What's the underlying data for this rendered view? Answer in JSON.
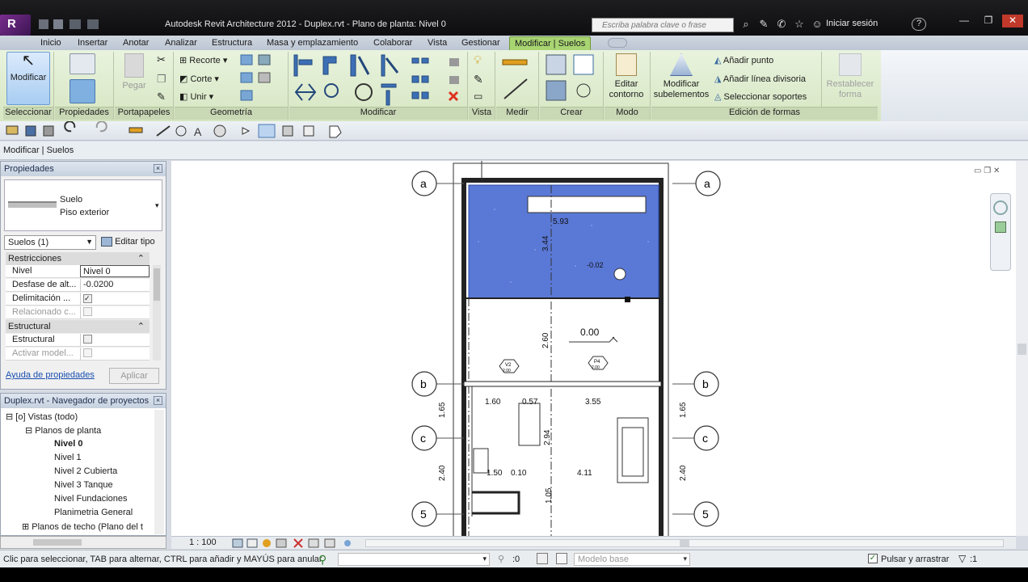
{
  "window": {
    "title": "Autodesk Revit Architecture 2012 -     Duplex.rvt - Plano de planta: Nivel 0",
    "search_placeholder": "Escriba palabra clave o frase",
    "login_label": "Iniciar sesión",
    "help_label": "?"
  },
  "tabs": [
    "Inicio",
    "Insertar",
    "Anotar",
    "Analizar",
    "Estructura",
    "Masa y emplazamiento",
    "Colaborar",
    "Vista",
    "Gestionar",
    "Modificar | Suelos"
  ],
  "ribbon": {
    "modify_label": "Modificar",
    "paste_label": "Pegar",
    "recorte_label": "Recorte",
    "corte_label": "Corte",
    "unir_label": "Unir",
    "edit_contour_label": "Editar contorno",
    "modify_subelements_label": "Modificar subelementos",
    "add_point_label": "Añadir punto",
    "add_split_line_label": "Añadir línea divisoria",
    "select_supports_label": "Seleccionar soportes",
    "reset_shape_label": "Restablecer forma",
    "panels": [
      "Seleccionar",
      "Propiedades",
      "Portapapeles",
      "Geometría",
      "Modificar",
      "Vista",
      "Medir",
      "Crear",
      "Modo",
      "Edición de formas"
    ]
  },
  "context_bar": "Modificar | Suelos",
  "properties": {
    "header": "Propiedades",
    "type_line1": "Suelo",
    "type_line2": "Piso exterior",
    "filter_value": "Suelos (1)",
    "edit_type_label": "Editar tipo",
    "group_restricciones": "Restricciones",
    "rows": [
      {
        "key": "Nivel",
        "value": "Nivel 0"
      },
      {
        "key": "Desfase de alt...",
        "value": "-0.0200"
      },
      {
        "key": "Delimitación ...",
        "value": ""
      },
      {
        "key": "Relacionado c...",
        "value": ""
      }
    ],
    "group_estructural": "Estructural",
    "rows2": [
      {
        "key": "Estructural",
        "value": ""
      },
      {
        "key": "Activar model...",
        "value": ""
      }
    ],
    "help_link": "Ayuda de propiedades",
    "apply_label": "Aplicar"
  },
  "browser": {
    "header": "Duplex.rvt - Navegador de proyectos",
    "root": "Vistas (todo)",
    "group1": "Planos de planta",
    "items": [
      "Nivel 0",
      "Nivel 1",
      "Nivel 2 Cubierta",
      "Nivel 3 Tanque",
      "Nivel Fundaciones",
      "Planimetria General"
    ],
    "group2": "Planos de techo (Plano del t"
  },
  "drawing": {
    "grid_a": "a",
    "grid_b": "b",
    "grid_c": "c",
    "grid_5": "5",
    "dims": {
      "d593": "5.93",
      "d344": "3.44",
      "d002n": "-0.02",
      "d000": "0.00",
      "d260": "2.60",
      "d160": "1.60",
      "d057": "0.57",
      "d355": "3.55",
      "d294": "2.94",
      "d165": "1.65",
      "d150": "1.50",
      "d010": "0.10",
      "d411": "4.11",
      "d240": "2.40",
      "d105": "1.05"
    },
    "tag_v2": "V2",
    "tag_v2b": "2.00",
    "tag_p4": "P4",
    "tag_p4b": "2.00"
  },
  "view_control": {
    "scale": "1 : 100"
  },
  "status": {
    "message": "Clic para seleccionar, TAB para alternar, CTRL para añadir y MAYÚS para anular",
    "count": ":0",
    "model": "Modelo base",
    "drag_label": "Pulsar y arrastrar",
    "filter_count": ":1"
  },
  "colors": {
    "floor_fill": "#5a78d6",
    "ribbon_green": "#a8d472"
  }
}
